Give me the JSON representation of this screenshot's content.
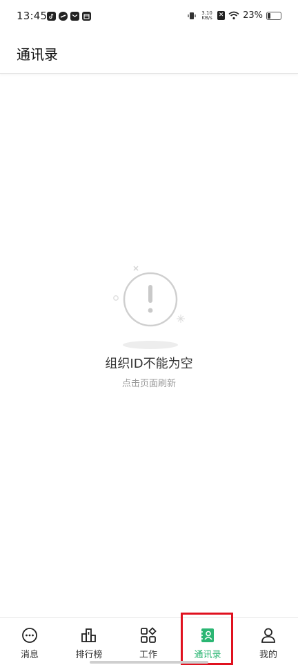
{
  "status_bar": {
    "time": "13:45",
    "app_icons": [
      "tiktok-icon",
      "link-icon",
      "mail-icon",
      "calendar-icon"
    ],
    "net_speed_value": "3.10",
    "net_speed_unit": "KB/s",
    "battery_percent": "23%",
    "battery_level": 0.23
  },
  "header": {
    "title": "通讯录"
  },
  "empty_state": {
    "icon": "warning-icon",
    "title": "组织ID不能为空",
    "subtitle": "点击页面刷新"
  },
  "bottom_nav": {
    "items": [
      {
        "label": "消息",
        "icon": "chat-bubble-icon"
      },
      {
        "label": "排行榜",
        "icon": "leaderboard-icon"
      },
      {
        "label": "工作",
        "icon": "apps-grid-icon"
      },
      {
        "label": "通讯录",
        "icon": "contacts-book-icon",
        "active": true
      },
      {
        "label": "我的",
        "icon": "user-profile-icon"
      }
    ],
    "active_color": "#2bb673",
    "highlight_color": "#e0111f"
  }
}
